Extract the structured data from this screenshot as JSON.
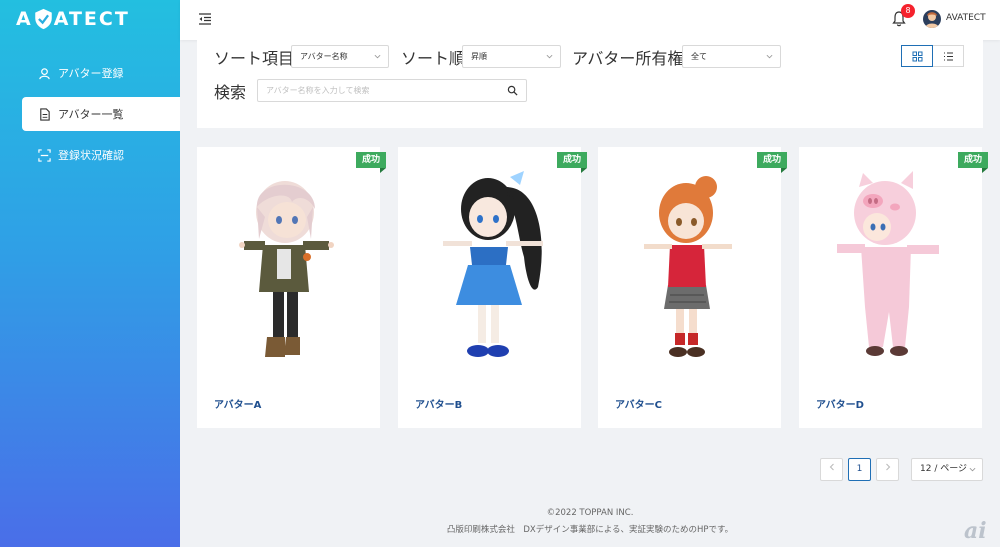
{
  "app": {
    "logo_text_left": "A",
    "logo_text_right": "ATECT"
  },
  "sidebar": {
    "items": [
      {
        "label": "アバター登録",
        "icon": "user-icon"
      },
      {
        "label": "アバター一覧",
        "icon": "document-icon",
        "active": true
      },
      {
        "label": "登録状況確認",
        "icon": "scan-icon"
      }
    ]
  },
  "header": {
    "notification_count": "8",
    "username": "AVATECT"
  },
  "filter": {
    "sort_field_label": "ソート項目",
    "sort_field_value": "アバター名称",
    "sort_order_label": "ソート順",
    "sort_order_value": "昇順",
    "ownership_label": "アバター所有権",
    "ownership_value": "全て",
    "search_label": "検索",
    "search_placeholder": "アバター名称を入力して検索",
    "view_modes": [
      "grid-view-icon",
      "list-view-icon"
    ]
  },
  "cards": [
    {
      "name": "アバターA",
      "status": "成功"
    },
    {
      "name": "アバターB",
      "status": "成功"
    },
    {
      "name": "アバターC",
      "status": "成功"
    },
    {
      "name": "アバターD",
      "status": "成功"
    }
  ],
  "pagination": {
    "current_page": "1",
    "page_size": "12 / ページ"
  },
  "footer": {
    "copyright": "©2022 TOPPAN INC.",
    "note": "凸版印刷株式会社　DXデザイン事業部による、実証実験のためのHPです。"
  },
  "watermark": "ai",
  "colors": {
    "accent": "#1f6fb5",
    "success": "#3daa5e",
    "sidebar_top": "#23bfe0",
    "sidebar_bottom": "#4a6ee8"
  }
}
